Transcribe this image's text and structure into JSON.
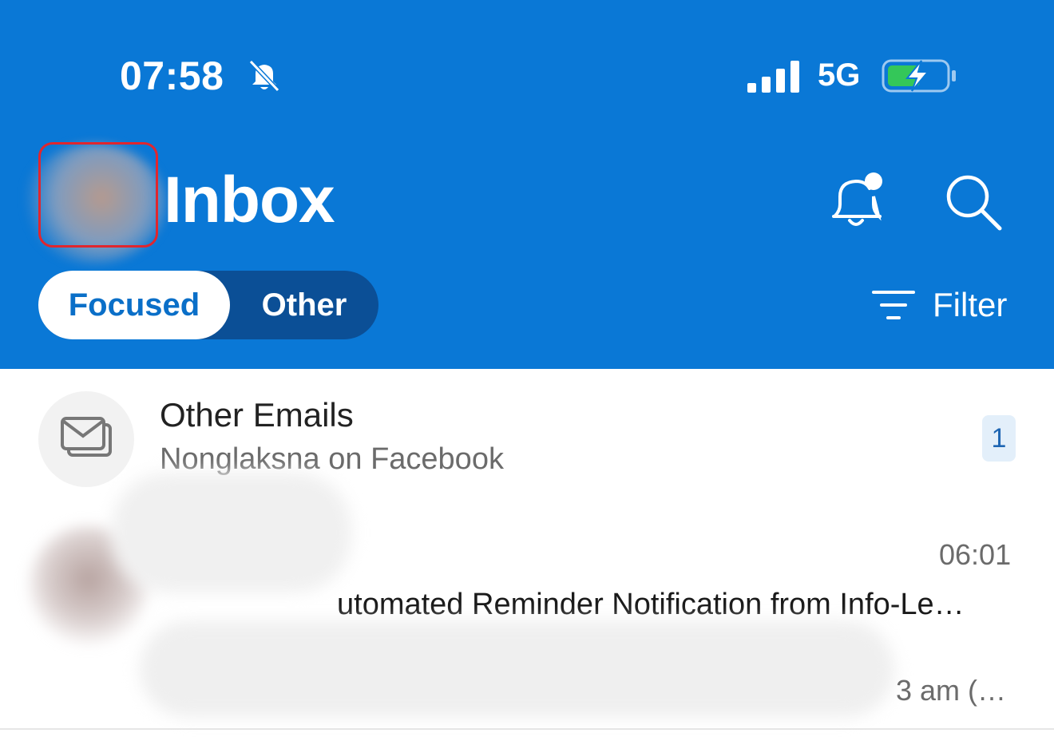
{
  "status_bar": {
    "time": "07:58",
    "network": "5G",
    "icons": [
      "bell-slash-icon",
      "signal-icon",
      "battery-charging-icon"
    ]
  },
  "header": {
    "title": "Inbox",
    "icons": [
      "notification-bell-icon",
      "search-icon"
    ]
  },
  "tabs": {
    "focused": "Focused",
    "other": "Other",
    "selected": "Focused"
  },
  "filter": {
    "label": "Filter",
    "icon": "filter-icon"
  },
  "colors": {
    "header_bg": "#0a78d6",
    "segment_bg": "#0b4f96",
    "accent": "#0a6fc8",
    "badge_bg": "#e3effa"
  },
  "list": {
    "other_emails": {
      "title": "Other Emails",
      "subtitle": "Nonglaksna on Facebook",
      "count": "1",
      "icon": "envelope-stack-icon"
    },
    "message": {
      "time": "06:01",
      "subject": "utomated Reminder Notification from Info-Le…",
      "preview": "3 am (…"
    }
  }
}
